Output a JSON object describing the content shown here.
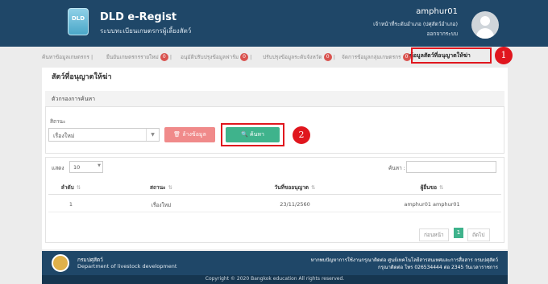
{
  "header": {
    "app_title": "DLD e-Regist",
    "app_subtitle": "ระบบทะเบียนเกษตรกรผู้เลี้ยงสัตว์",
    "user_name": "amphur01",
    "user_role": "เจ้าหน้าที่ระดับอำเภอ (ปศุสัตว์อำเภอ)",
    "logout": "ออกจากระบบ"
  },
  "tabs": [
    {
      "label": "ค้นหาข้อมูลเกษตรกร",
      "badge": ""
    },
    {
      "label": "ยืนยันเกษตรกรรายใหม่",
      "badge": "0"
    },
    {
      "label": "อนุมัติปรับปรุงข้อมูลฟาร์ม",
      "badge": "0"
    },
    {
      "label": "ปรับปรุงข้อมูลระดับจังหวัด",
      "badge": "0"
    },
    {
      "label": "จัดการข้อมูลกลุ่มเกษตรกร",
      "badge": "0"
    },
    {
      "label": "ข้อมูลสัตว์ที่อนุญาตให้ฆ่า",
      "badge": ""
    }
  ],
  "markers": {
    "one": "1",
    "two": "2"
  },
  "page_title": "สัตว์ที่อนุญาตให้ฆ่า",
  "filter": {
    "title": "ตัวกรองการค้นหา",
    "status_label": "สิถานะ",
    "status_value": "เรื่องใหม่",
    "clear_button": "ล้างข้อมูล",
    "search_button": "ค้นหา"
  },
  "table": {
    "length_label": "แสดง",
    "length_value": "10",
    "search_label": "ค้นหา :",
    "columns": [
      "ลำดับ",
      "สถานะ",
      "วันที่ขออนุญาต",
      "ผู้ยื่นขอ"
    ],
    "rows": [
      [
        "1",
        "เรื่องใหม่",
        "23/11/2560",
        "amphur01 amphur01"
      ]
    ]
  },
  "pager": {
    "prev": "ก่อนหน้า",
    "page": "1",
    "next": "ถัดไป"
  },
  "footer": {
    "org_name": "กรมปศุสัตว์",
    "dept": "Department of livestock development",
    "contact1": "หากพบปัญหาการใช้งานกรุณาติดต่อ ศูนย์เทคโนโลยีสารสนเทศและการสื่อสาร กรมปศุสัตว์",
    "contact2": "กรุณาติดต่อ โทร 026534444 ต่อ 2345 วันเวลาราชการ",
    "copyright": "Copyright © 2020 Bangkok education All rights reserved."
  },
  "colors": {
    "header_bg": "#1f4768",
    "search_button": "#3fb38c",
    "clear_button": "#f08a8a",
    "highlight": "#e0161e"
  }
}
